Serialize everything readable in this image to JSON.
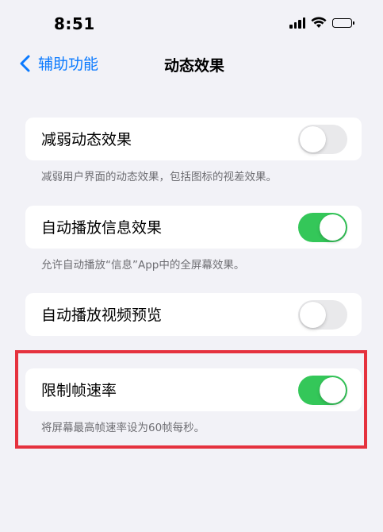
{
  "status_bar": {
    "time": "8:51",
    "icons": [
      "cellular-signal-icon",
      "wifi-icon",
      "battery-icon"
    ]
  },
  "nav": {
    "back_label": "辅助功能",
    "title": "动态效果"
  },
  "settings": [
    {
      "label": "减弱动态效果",
      "enabled": false,
      "footer": "减弱用户界面的动态效果，包括图标的视差效果。"
    },
    {
      "label": "自动播放信息效果",
      "enabled": true,
      "footer": "允许自动播放“信息”App中的全屏幕效果。"
    },
    {
      "label": "自动播放视频预览",
      "enabled": false,
      "footer": ""
    },
    {
      "label": "限制帧速率",
      "enabled": true,
      "footer": "将屏幕最高帧速率设为60帧每秒。"
    }
  ],
  "colors": {
    "accent": "#0a7aff",
    "toggle_on": "#34c759",
    "toggle_off": "#e9e9eb",
    "background": "#f2f2f7",
    "highlight": "#e5323e"
  }
}
